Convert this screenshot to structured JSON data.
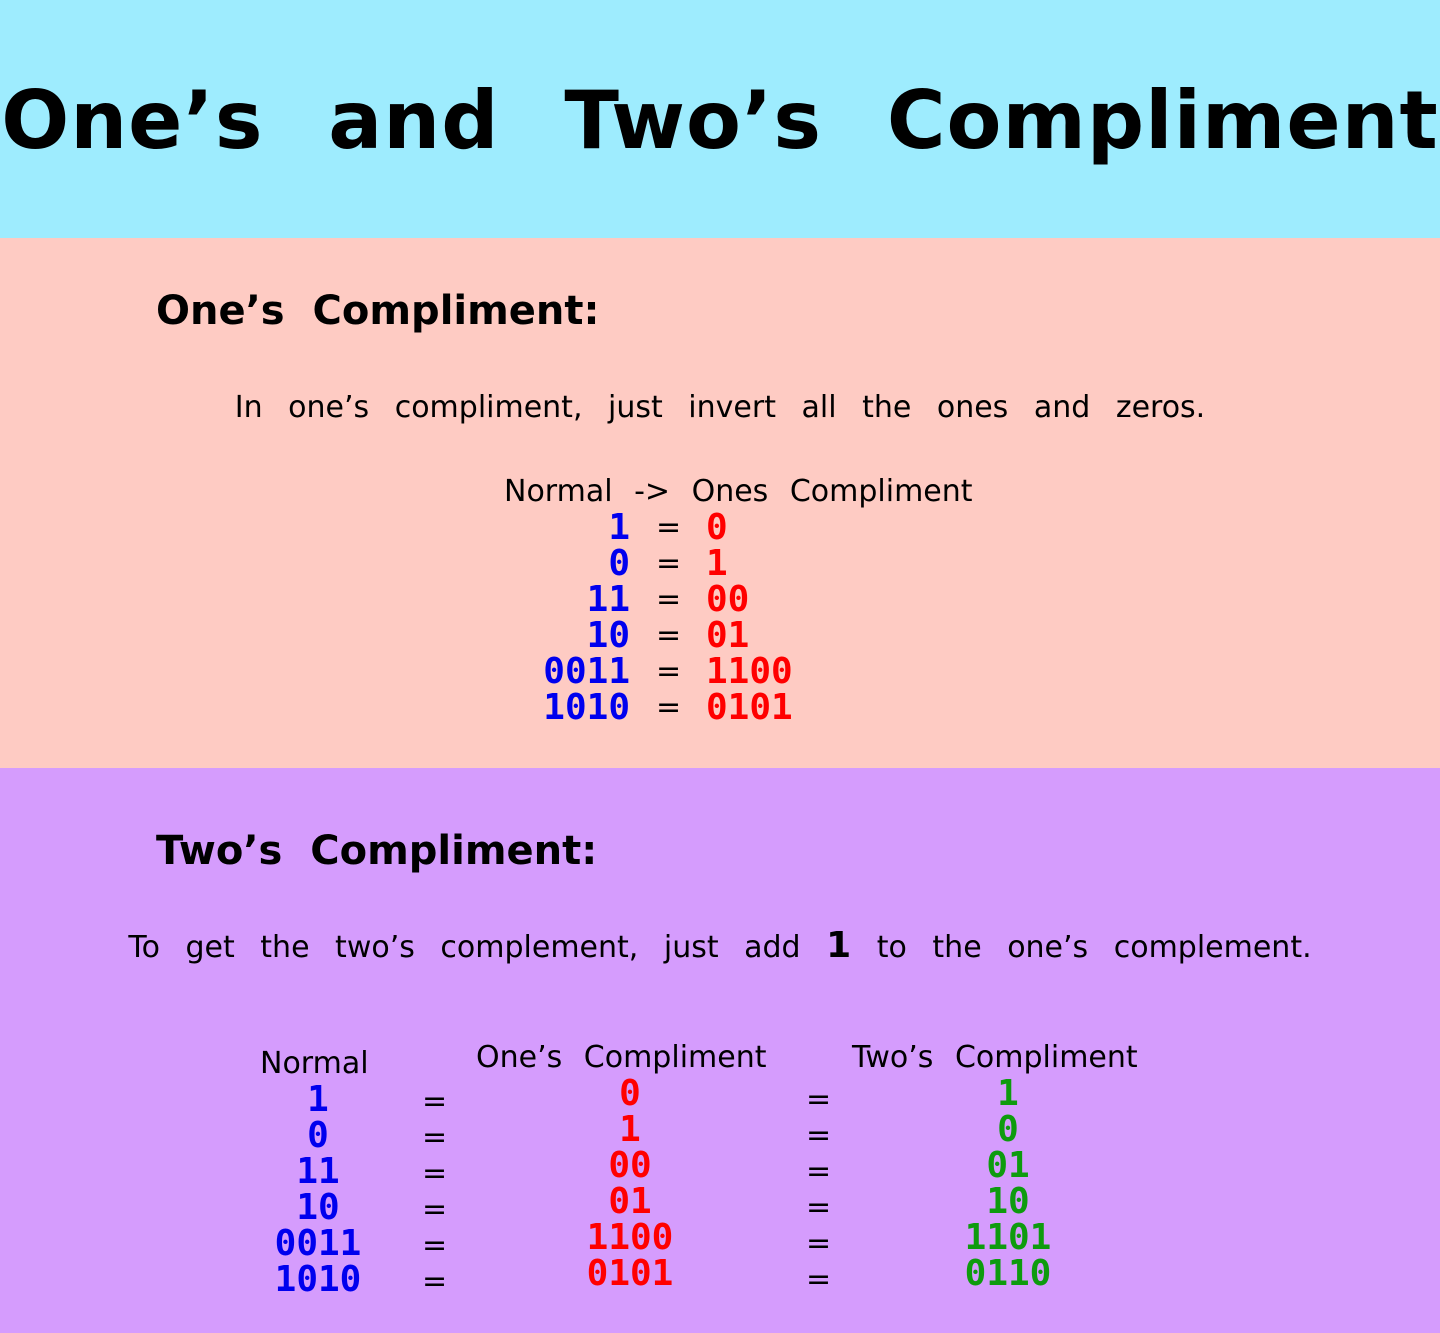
{
  "title": "One’s and Two’s Compliment",
  "ones_section": {
    "heading": "One’s Compliment:",
    "description": "In one’s compliment, just invert all the ones and zeros.",
    "header": "Normal -> Ones Compliment",
    "rows": [
      {
        "normal": "1",
        "ones": "0"
      },
      {
        "normal": "0",
        "ones": "1"
      },
      {
        "normal": "11",
        "ones": "00"
      },
      {
        "normal": "10",
        "ones": "01"
      },
      {
        "normal": "0011",
        "ones": "1100"
      },
      {
        "normal": "1010",
        "ones": "0101"
      }
    ],
    "eq": "="
  },
  "twos_section": {
    "heading": "Two’s Compliment:",
    "description_before": "To get the two’s complement, just add",
    "description_number": "1",
    "description_after": "to the one’s complement.",
    "headers": {
      "normal": "Normal",
      "ones": "One’s Compliment",
      "twos": "Two’s Compliment"
    },
    "rows": [
      {
        "normal": "1",
        "ones": "0",
        "twos": "1"
      },
      {
        "normal": "0",
        "ones": "1",
        "twos": "0"
      },
      {
        "normal": "11",
        "ones": "00",
        "twos": "01"
      },
      {
        "normal": "10",
        "ones": "01",
        "twos": "10"
      },
      {
        "normal": "0011",
        "ones": "1100",
        "twos": "1101"
      },
      {
        "normal": "1010",
        "ones": "0101",
        "twos": "0110"
      }
    ],
    "eq": "="
  },
  "colors": {
    "title_band": "#9eecfe",
    "ones_band": "#fecbc3",
    "twos_band": "#d59cfd",
    "normal_digits": "#0000ee",
    "ones_digits": "#ff0000",
    "twos_digits": "#0e9b0e"
  }
}
